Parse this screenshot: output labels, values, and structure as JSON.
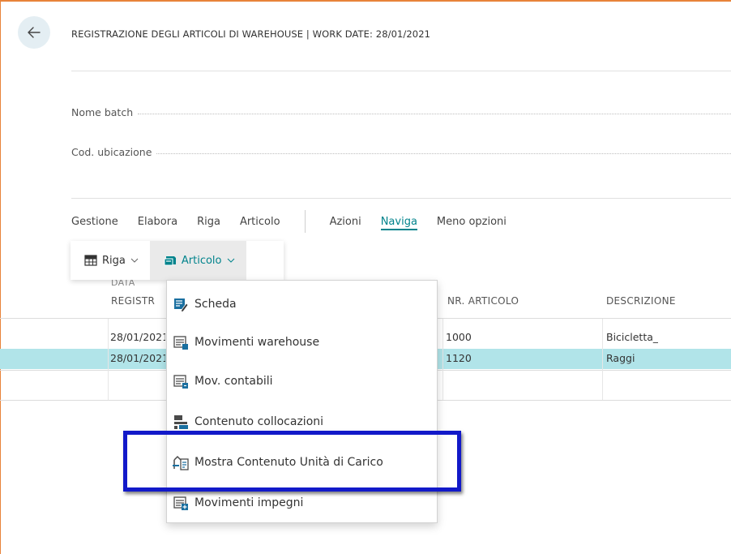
{
  "header": {
    "title": "REGISTRAZIONE DEGLI ARTICOLI DI WAREHOUSE | WORK DATE: 28/01/2021"
  },
  "fields": [
    {
      "label": "Nome batch"
    },
    {
      "label": "Cod. ubicazione"
    }
  ],
  "actions": {
    "items": [
      "Gestione",
      "Elabora",
      "Riga",
      "Articolo"
    ],
    "items2": [
      "Azioni",
      "Naviga",
      "Meno opzioni"
    ],
    "active": "Naviga"
  },
  "subbar": {
    "riga": "Riga",
    "articolo": "Articolo"
  },
  "grid": {
    "columns": {
      "date_line1": "DATA",
      "date_line2": "REGISTR",
      "item_no": "NR. ARTICOLO",
      "description": "DESCRIZIONE"
    },
    "rows": [
      {
        "date": "28/01/2021",
        "item_no": "1000",
        "description": "Bicicletta_",
        "selected": false
      },
      {
        "date": "28/01/2021",
        "item_no": "1120",
        "description": "Raggi",
        "selected": true
      }
    ]
  },
  "menu": {
    "items": [
      {
        "label": "Scheda",
        "icon": "card-edit-icon"
      },
      {
        "label": "Movimenti warehouse",
        "icon": "warehouse-entries-icon"
      },
      {
        "label": "Mov. contabili",
        "icon": "ledger-entries-icon"
      },
      {
        "label": "Contenuto collocazioni",
        "icon": "bin-contents-icon"
      },
      {
        "label": "Mostra Contenuto Unità di Carico",
        "icon": "handling-unit-icon"
      },
      {
        "label": "Movimenti impegni",
        "icon": "reservation-entries-icon"
      }
    ],
    "highlighted": "Mostra Contenuto Unità di Carico"
  },
  "colors": {
    "accent": "#00838c",
    "selected_row": "#b1e4e9",
    "highlight_border": "#1219c9",
    "frame": "#e8833a"
  }
}
